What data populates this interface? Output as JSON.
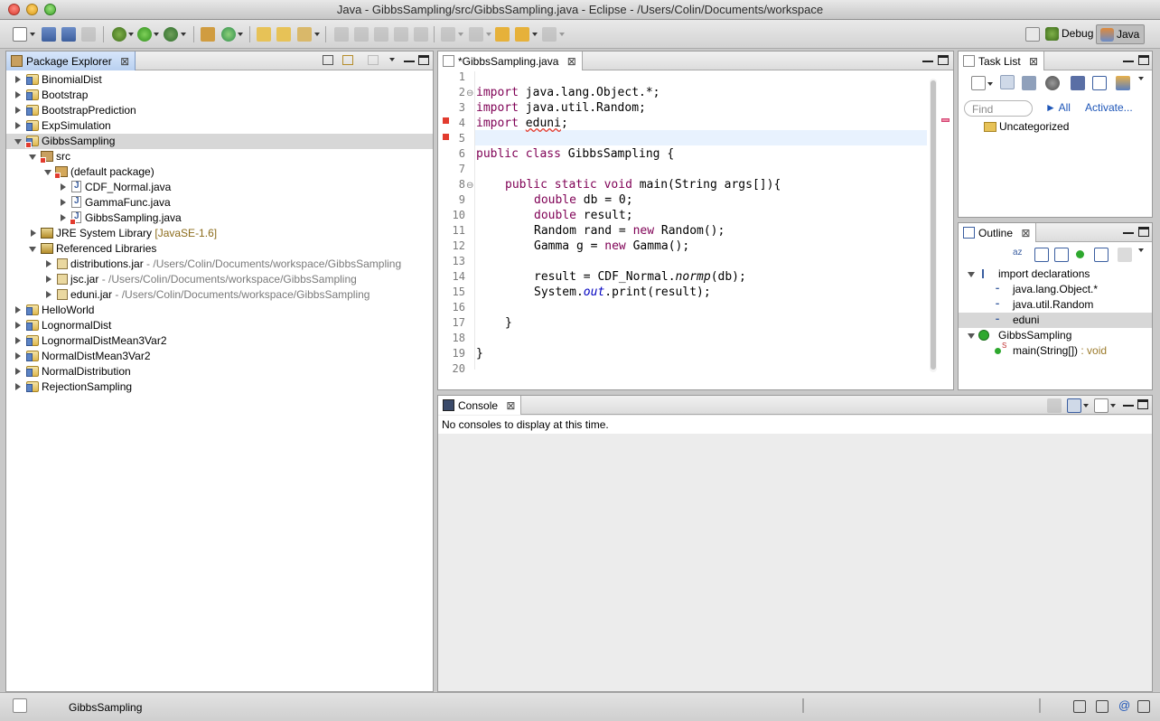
{
  "window": {
    "title": "Java - GibbsSampling/src/GibbsSampling.java - Eclipse - /Users/Colin/Documents/workspace"
  },
  "toolbar": {
    "perspectives": [
      {
        "label": "Debug",
        "active": false
      },
      {
        "label": "Java",
        "active": true
      }
    ]
  },
  "package_explorer": {
    "tab_label": "Package Explorer",
    "rows": [
      {
        "label": "BinomialDist",
        "extra": ""
      },
      {
        "label": "Bootstrap",
        "extra": ""
      },
      {
        "label": "BootstrapPrediction",
        "extra": ""
      },
      {
        "label": "ExpSimulation",
        "extra": ""
      },
      {
        "label": "GibbsSampling",
        "extra": ""
      },
      {
        "label": "src",
        "extra": ""
      },
      {
        "label": "(default package)",
        "extra": ""
      },
      {
        "label": "CDF_Normal.java",
        "extra": ""
      },
      {
        "label": "GammaFunc.java",
        "extra": ""
      },
      {
        "label": "GibbsSampling.java",
        "extra": ""
      },
      {
        "label": "JRE System Library",
        "extra": "[JavaSE-1.6]"
      },
      {
        "label": "Referenced Libraries",
        "extra": ""
      },
      {
        "label": "distributions.jar",
        "extra": "- /Users/Colin/Documents/workspace/GibbsSampling"
      },
      {
        "label": "jsc.jar",
        "extra": "- /Users/Colin/Documents/workspace/GibbsSampling"
      },
      {
        "label": "eduni.jar",
        "extra": "- /Users/Colin/Documents/workspace/GibbsSampling"
      },
      {
        "label": "HelloWorld",
        "extra": ""
      },
      {
        "label": "LognormalDist",
        "extra": ""
      },
      {
        "label": "LognormalDistMean3Var2",
        "extra": ""
      },
      {
        "label": "NormalDistMean3Var2",
        "extra": ""
      },
      {
        "label": "NormalDistribution",
        "extra": ""
      },
      {
        "label": "RejectionSampling",
        "extra": ""
      }
    ]
  },
  "editor": {
    "tab_label": "*GibbsSampling.java",
    "line_numbers": [
      "1",
      "2",
      "3",
      "4",
      "5",
      "6",
      "7",
      "8",
      "9",
      "10",
      "11",
      "12",
      "13",
      "14",
      "15",
      "16",
      "17",
      "18",
      "19",
      "20"
    ],
    "code": {
      "l2_kw": "import",
      "l2": " java.lang.Object.*;",
      "l3_kw": "import",
      "l3": " java.util.Random;",
      "l4_kw": "import",
      "l4_a": " ",
      "l4_err": "eduni",
      "l4_b": ";",
      "l6_kw1": "public",
      "l6_kw2": "class",
      "l6": " GibbsSampling {",
      "l8_kw1": "public",
      "l8_kw2": "static",
      "l8_kw3": "void",
      "l8": " main(String args[]){",
      "l9_kw": "double",
      "l9": " db = 0;",
      "l10_kw": "double",
      "l10": " result;",
      "l11_a": "Random rand = ",
      "l11_kw": "new",
      "l11_b": " Random();",
      "l12_a": "Gamma g = ",
      "l12_kw": "new",
      "l12_b": " Gamma();",
      "l14_a": "result = CDF_Normal.",
      "l14_it": "normp",
      "l14_b": "(db);",
      "l15_a": "System.",
      "l15_fld": "out",
      "l15_b": ".print(result);",
      "l17": "}",
      "l19": "}"
    }
  },
  "task_list": {
    "tab_label": "Task List",
    "find_placeholder": "Find",
    "all_label": "All",
    "activate_label": "Activate...",
    "category": "Uncategorized"
  },
  "outline": {
    "tab_label": "Outline",
    "imports_label": "import declarations",
    "imports": [
      "java.lang.Object.*",
      "java.util.Random",
      "eduni"
    ],
    "class_label": "GibbsSampling",
    "method_label": "main(String[])",
    "method_return": ": void"
  },
  "console": {
    "tab_label": "Console",
    "message": "No consoles to display at this time."
  },
  "status": {
    "text": "GibbsSampling"
  }
}
